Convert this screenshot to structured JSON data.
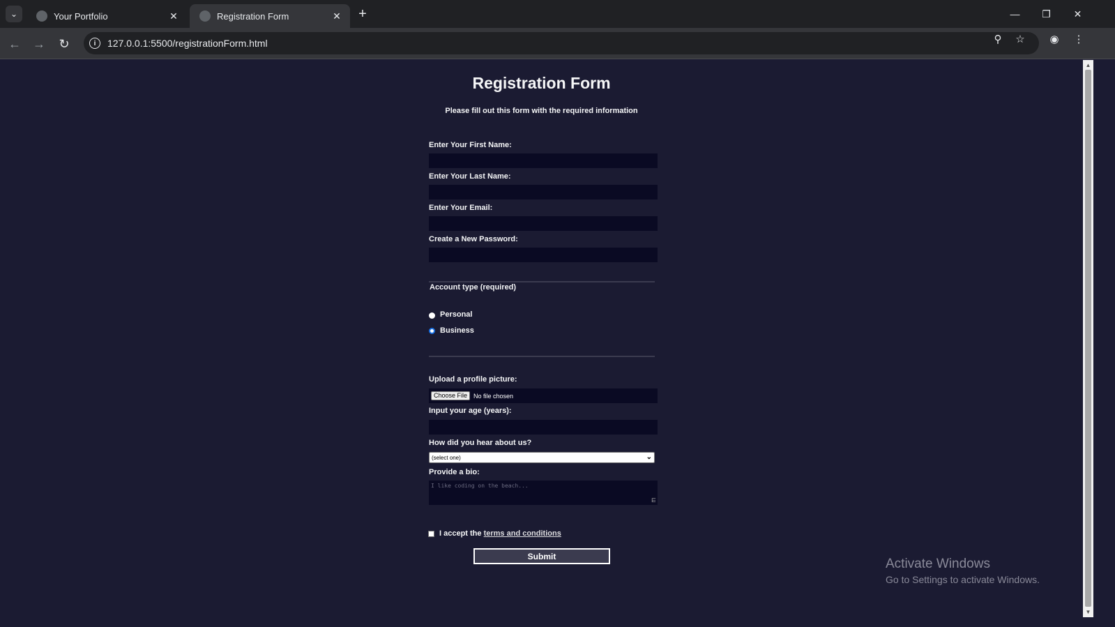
{
  "browser": {
    "tabs": [
      {
        "title": "Your Portfolio",
        "active": false
      },
      {
        "title": "Registration Form",
        "active": true
      }
    ],
    "url": "127.0.0.1:5500/registrationForm.html"
  },
  "form": {
    "title": "Registration Form",
    "subtitle": "Please fill out this form with the required information",
    "first_name_label": "Enter Your First Name:",
    "last_name_label": "Enter Your Last Name:",
    "email_label": "Enter Your Email:",
    "password_label": "Create a New Password:",
    "account_legend": "Account type (required)",
    "account_options": [
      {
        "label": "Personal",
        "checked": false
      },
      {
        "label": "Business",
        "checked": true
      }
    ],
    "upload_label": "Upload a profile picture:",
    "file_button": "Choose File",
    "file_status": "No file chosen",
    "age_label": "Input your age (years):",
    "referrer_label": "How did you hear about us?",
    "referrer_selected": "(select one)",
    "bio_label": "Provide a bio:",
    "bio_placeholder": "I like coding on the beach...",
    "terms_prefix": "I accept the",
    "terms_link": "terms and conditions",
    "submit_label": "Submit"
  },
  "watermark": {
    "line1": "Activate Windows",
    "line2": "Go to Settings to activate Windows."
  },
  "colors": {
    "page_bg": "#1b1b32",
    "input_bg": "#0a0a23",
    "submit_bg": "#3b3b4f"
  }
}
